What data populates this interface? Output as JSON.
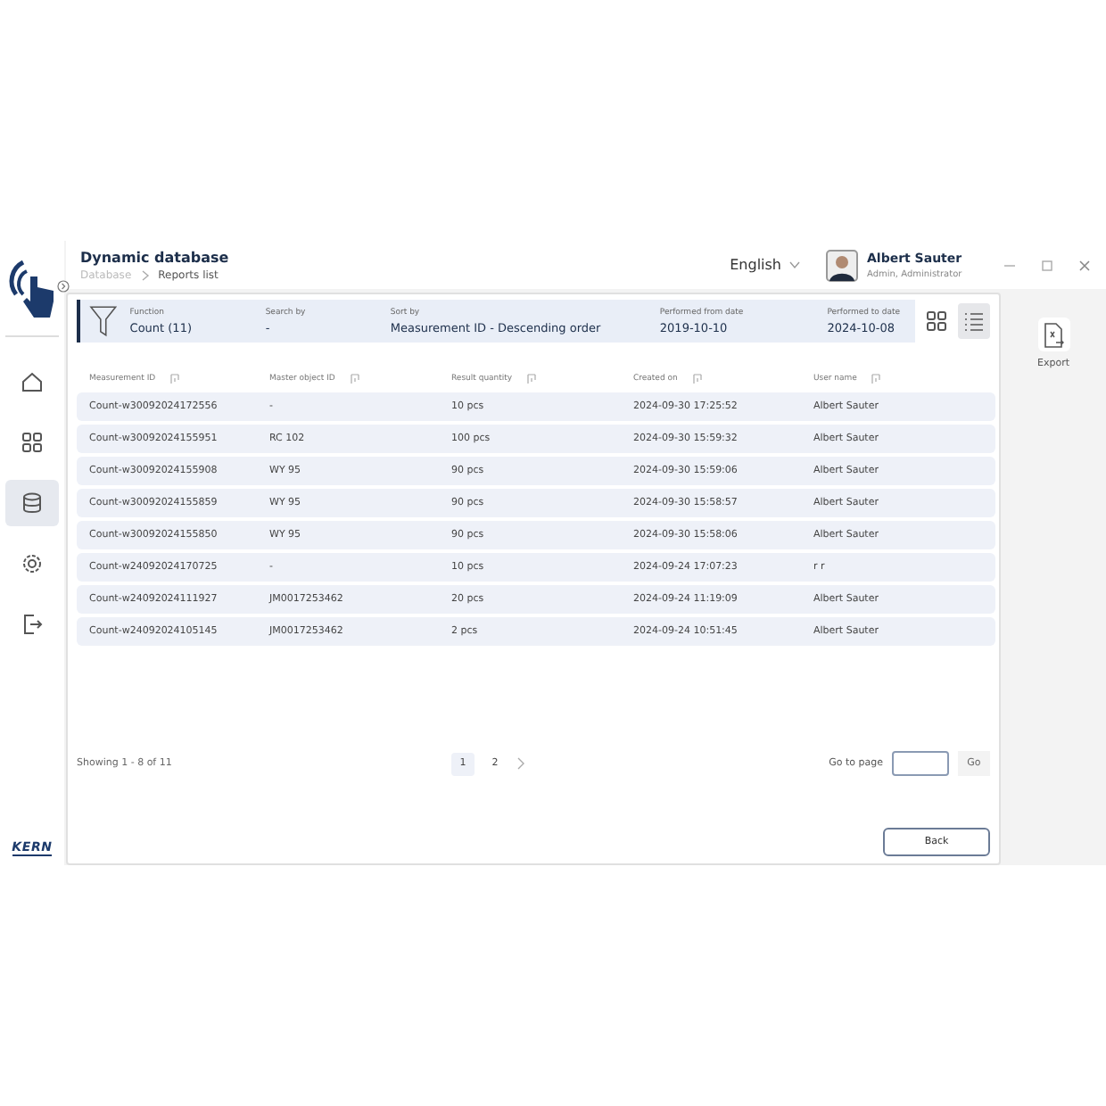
{
  "window": {
    "title": "Dynamic database"
  },
  "breadcrumb": [
    {
      "label": "Database",
      "current": false
    },
    {
      "label": "Reports list",
      "current": true
    }
  ],
  "language": "English",
  "user": {
    "name": "Albert Sauter",
    "role": "Admin, Administrator"
  },
  "sidebar": {
    "items": [
      {
        "kind": "home",
        "selected": false
      },
      {
        "kind": "grid",
        "selected": false
      },
      {
        "kind": "database",
        "selected": true
      },
      {
        "kind": "settings",
        "selected": false
      },
      {
        "kind": "logout",
        "selected": false
      }
    ]
  },
  "logo": "KERN",
  "filters": [
    {
      "label": "Function",
      "value": "Count (11)"
    },
    {
      "label": "Search by",
      "value": "-"
    },
    {
      "label": "Sort by",
      "value": "Measurement ID - Descending order"
    },
    {
      "label": "Performed from date",
      "value": "2019-10-10"
    },
    {
      "label": "Performed to date",
      "value": "2024-10-08"
    }
  ],
  "view_modes": [
    {
      "kind": "grid",
      "selected": false
    },
    {
      "kind": "list",
      "selected": true
    }
  ],
  "table": {
    "columns": [
      "Measurement ID",
      "Master object ID",
      "Result quantity",
      "Created on",
      "User name"
    ],
    "rows": [
      [
        "Count-w30092024172556",
        "-",
        "10 pcs",
        "2024-09-30 17:25:52",
        "Albert Sauter"
      ],
      [
        "Count-w30092024155951",
        "RC 102",
        "100 pcs",
        "2024-09-30 15:59:32",
        "Albert Sauter"
      ],
      [
        "Count-w30092024155908",
        "WY 95",
        "90 pcs",
        "2024-09-30 15:59:06",
        "Albert Sauter"
      ],
      [
        "Count-w30092024155859",
        "WY 95",
        "90 pcs",
        "2024-09-30 15:58:57",
        "Albert Sauter"
      ],
      [
        "Count-w30092024155850",
        "WY 95",
        "90 pcs",
        "2024-09-30 15:58:06",
        "Albert Sauter"
      ],
      [
        "Count-w24092024170725",
        "-",
        "10 pcs",
        "2024-09-24 17:07:23",
        "r r"
      ],
      [
        "Count-w24092024111927",
        "JM0017253462",
        "20 pcs",
        "2024-09-24 11:19:09",
        "Albert Sauter"
      ],
      [
        "Count-w24092024105145",
        "JM0017253462",
        "2 pcs",
        "2024-09-24 10:51:45",
        "Albert Sauter"
      ]
    ]
  },
  "pagination": {
    "summary": "Showing 1 - 8 of 11",
    "pages": [
      {
        "label": "1",
        "selected": true
      },
      {
        "label": "2",
        "selected": false
      }
    ],
    "goto_label": "Go to page",
    "go_button": "Go"
  },
  "back_button": "Back",
  "side_actions": [
    {
      "kind": "export",
      "label": "Export"
    }
  ]
}
